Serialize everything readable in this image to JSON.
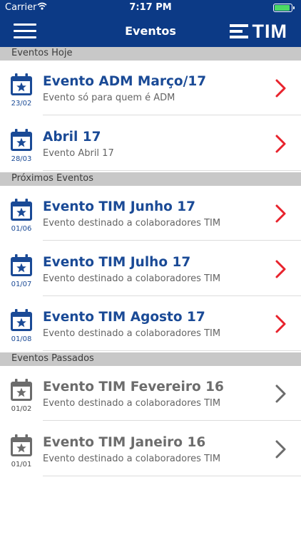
{
  "status_bar": {
    "carrier": "Carrier",
    "time": "7:17 PM",
    "battery_level": 0.9
  },
  "nav": {
    "title": "Eventos",
    "brand": "TIM"
  },
  "colors": {
    "nav_blue": "#0c3a86",
    "active_blue": "#1a4a96",
    "inactive_gray": "#6c6c6c",
    "chevron_red": "#e8232d",
    "chevron_gray": "#6c6c6c",
    "section_gray": "#c8c8c8"
  },
  "sections": [
    {
      "header": "Eventos Hoje",
      "state": "today",
      "events": [
        {
          "date": "23/02",
          "title": "Evento ADM Março/17",
          "subtitle": "Evento só para quem é ADM"
        },
        {
          "date": "28/03",
          "title": "Abril 17",
          "subtitle": "Evento Abril 17"
        }
      ]
    },
    {
      "header": "Próximos Eventos",
      "state": "upcoming",
      "events": [
        {
          "date": "01/06",
          "title": "Evento TIM Junho 17",
          "subtitle": "Evento destinado a colaboradores TIM"
        },
        {
          "date": "01/07",
          "title": "Evento TIM Julho 17",
          "subtitle": "Evento destinado a colaboradores TIM"
        },
        {
          "date": "01/08",
          "title": "Evento TIM Agosto 17",
          "subtitle": "Evento destinado a colaboradores TIM"
        }
      ]
    },
    {
      "header": "Eventos Passados",
      "state": "past",
      "events": [
        {
          "date": "01/02",
          "title": "Evento TIM Fevereiro 16",
          "subtitle": "Evento destinado a colaboradores TIM"
        },
        {
          "date": "01/01",
          "title": "Evento TIM Janeiro 16",
          "subtitle": "Evento destinado a colaboradores TIM"
        }
      ]
    }
  ]
}
